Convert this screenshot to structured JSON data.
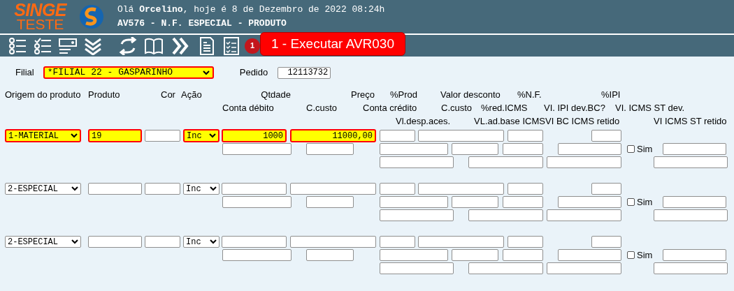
{
  "header": {
    "logo_top": "SINGE",
    "logo_bottom": "TESTE",
    "greeting": "Olá **Orcelino**, hoje é 8 de Dezembro de 2022 08:24h",
    "screen_title": "AV576 - N.F. ESPECIAL - PRODUTO"
  },
  "toolbar": {
    "badge": "1",
    "tooltip": "1 - Executar AVR030"
  },
  "filial": {
    "label": "Filial",
    "value": "*FILIAL 22 - GASPARINHO",
    "highlighted": true
  },
  "pedido": {
    "label": "Pedido",
    "value": "12113732"
  },
  "column_labels": [
    [
      "Origem do produto",
      "Produto",
      "Cor",
      "Ação",
      "Qtdade",
      "Preço",
      "%Prod",
      "Valor desconto",
      "%N.F.",
      "%IPI"
    ],
    [
      "Conta débito",
      "C.custo",
      "Conta crédito",
      "C.custo",
      "%red.ICMS",
      "VI. IPI dev.BC?",
      "VI. ICMS ST dev."
    ],
    [
      "Vl.desp.aces.",
      "VL.ad.base ICMS",
      "VI BC ICMS retido",
      "VI ICMS ST retido"
    ]
  ],
  "rows": [
    {
      "fields": [
        {
          "value": "1-MATERIAL",
          "highlighted": true
        },
        {
          "value": "19",
          "highlighted": true
        },
        {
          "highlighted": false
        },
        {
          "value": "Inc",
          "highlighted": true
        },
        {
          "value": "1000",
          "highlighted": true
        },
        {
          "value": "11000,00",
          "highlighted": true
        },
        {
          "highlighted": false
        },
        {
          "highlighted": false
        },
        {
          "highlighted": false
        },
        {
          "highlighted": false
        },
        {
          "highlighted": false
        },
        {
          "highlighted": false
        },
        {
          "highlighted": false
        },
        {
          "highlighted": false
        },
        {
          "highlighted": false
        },
        {
          "highlighted": false
        },
        {
          "highlighted": false
        },
        {
          "highlighted": false
        },
        {
          "highlighted": false
        },
        {
          "highlighted": false
        },
        {
          "highlighted": false
        }
      ],
      "sim": {
        "label": "Sim",
        "checked": false
      }
    },
    {
      "fields": [
        {
          "value": "2-ESPECIAL",
          "highlighted": false
        },
        {
          "highlighted": false
        },
        {
          "highlighted": false
        },
        {
          "value": "Inc",
          "highlighted": false
        },
        {
          "highlighted": false
        },
        {
          "highlighted": false
        },
        {
          "highlighted": false
        },
        {
          "highlighted": false
        },
        {
          "highlighted": false
        },
        {
          "highlighted": false
        },
        {
          "highlighted": false
        },
        {
          "highlighted": false
        },
        {
          "highlighted": false
        },
        {
          "highlighted": false
        },
        {
          "highlighted": false
        },
        {
          "highlighted": false
        },
        {
          "highlighted": false
        },
        {
          "highlighted": false
        },
        {
          "highlighted": false
        },
        {
          "highlighted": false
        },
        {
          "highlighted": false
        }
      ],
      "sim": {
        "label": "Sim",
        "checked": false
      }
    },
    {
      "fields": [
        {
          "value": "2-ESPECIAL",
          "highlighted": false
        },
        {
          "highlighted": false
        },
        {
          "highlighted": false
        },
        {
          "value": "Inc",
          "highlighted": false
        },
        {
          "highlighted": false
        },
        {
          "highlighted": false
        },
        {
          "highlighted": false
        },
        {
          "highlighted": false
        },
        {
          "highlighted": false
        },
        {
          "highlighted": false
        },
        {
          "highlighted": false
        },
        {
          "highlighted": false
        },
        {
          "highlighted": false
        },
        {
          "highlighted": false
        },
        {
          "highlighted": false
        },
        {
          "highlighted": false
        },
        {
          "highlighted": false
        },
        {
          "highlighted": false
        },
        {
          "highlighted": false
        },
        {
          "highlighted": false
        },
        {
          "highlighted": false
        }
      ],
      "sim": {
        "label": "Sim",
        "checked": false
      }
    }
  ]
}
